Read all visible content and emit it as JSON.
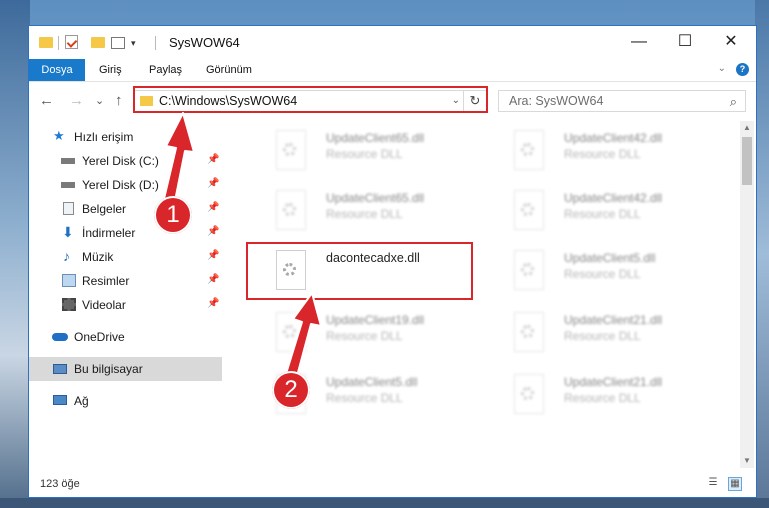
{
  "window": {
    "title": "SysWOW64",
    "minimize": "—",
    "maximize": "☐",
    "close": "✕"
  },
  "ribbon": {
    "tabs": [
      "Dosya",
      "Giriş",
      "Paylaş",
      "Görünüm"
    ],
    "caret": "⌄",
    "help": "?"
  },
  "nav": {
    "back": "←",
    "forward": "→",
    "recent": "⌄",
    "up": "↑"
  },
  "address": {
    "path": "C:\\Windows\\SysWOW64",
    "dropdown": "⌄",
    "refresh": "↻"
  },
  "search": {
    "placeholder": "Ara: SysWOW64",
    "icon": "⌕"
  },
  "sidebar": {
    "items": [
      {
        "label": "Hızlı erişim",
        "icon": "star-icon"
      },
      {
        "label": "Yerel Disk (C:)",
        "icon": "drive-icon",
        "pinned": true
      },
      {
        "label": "Yerel Disk (D:)",
        "icon": "drive-icon",
        "pinned": true
      },
      {
        "label": "Belgeler",
        "icon": "documents-icon",
        "pinned": true
      },
      {
        "label": "İndirmeler",
        "icon": "downloads-icon",
        "pinned": true
      },
      {
        "label": "Müzik",
        "icon": "music-icon",
        "pinned": true
      },
      {
        "label": "Resimler",
        "icon": "pictures-icon",
        "pinned": true
      },
      {
        "label": "Videolar",
        "icon": "videos-icon",
        "pinned": true
      },
      {
        "label": "OneDrive",
        "icon": "cloud-icon"
      },
      {
        "label": "Bu bilgisayar",
        "icon": "computer-icon",
        "selected": true
      },
      {
        "label": "Ağ",
        "icon": "network-icon"
      }
    ],
    "pin": "📌"
  },
  "files": [
    {
      "name": "UpdateClient65.dll",
      "desc": "Resource DLL"
    },
    {
      "name": "UpdateClient42.dll",
      "desc": "Resource DLL"
    },
    {
      "name": "UpdateClient65.dll",
      "desc": "Resource DLL"
    },
    {
      "name": "UpdateClient42.dll",
      "desc": "Resource DLL"
    },
    {
      "name": "dacontecadxe.dll",
      "desc": ""
    },
    {
      "name": "UpdateClient5.dll",
      "desc": "Resource DLL"
    },
    {
      "name": "UpdateClient19.dll",
      "desc": "Resource DLL"
    },
    {
      "name": "UpdateClient21.dll",
      "desc": "Resource DLL"
    },
    {
      "name": "UpdateClient5.dll",
      "desc": "Resource DLL"
    },
    {
      "name": "UpdateClient21.dll",
      "desc": "Resource DLL"
    }
  ],
  "status": {
    "count": "123 öğe"
  },
  "annotations": {
    "badge1": "1",
    "badge2": "2",
    "color": "#d9262b"
  }
}
